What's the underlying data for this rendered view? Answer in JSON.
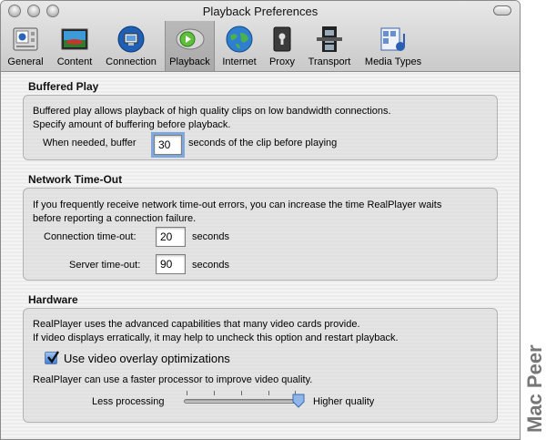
{
  "window": {
    "title": "Playback Preferences"
  },
  "toolbar": {
    "items": [
      {
        "label": "General",
        "icon": "general-panel-icon"
      },
      {
        "label": "Content",
        "icon": "content-image-icon"
      },
      {
        "label": "Connection",
        "icon": "connection-globe-icon"
      },
      {
        "label": "Playback",
        "icon": "playback-icon",
        "selected": true
      },
      {
        "label": "Internet",
        "icon": "internet-globe-icon"
      },
      {
        "label": "Proxy",
        "icon": "proxy-lock-icon"
      },
      {
        "label": "Transport",
        "icon": "transport-film-icon"
      },
      {
        "label": "Media Types",
        "icon": "media-types-icon"
      }
    ]
  },
  "buffered": {
    "title": "Buffered Play",
    "line1": "Buffered play allows playback of high quality clips on low bandwidth connections.",
    "line2": "Specify amount of buffering before playback.",
    "prefix": "When needed, buffer",
    "value": "30",
    "suffix": "seconds of the clip before playing"
  },
  "network": {
    "title": "Network Time-Out",
    "line1": "If you frequently receive network time-out errors, you can increase the time RealPlayer waits",
    "line2": "before reporting a connection failure.",
    "connection_label": "Connection time-out:",
    "connection_value": "20",
    "connection_unit": "seconds",
    "server_label": "Server time-out:",
    "server_value": "90",
    "server_unit": "seconds"
  },
  "hardware": {
    "title": "Hardware",
    "line1": "RealPlayer uses the advanced capabilities that many video cards provide.",
    "line2": "If video displays erratically, it may help to uncheck this option and restart playback.",
    "overlay_label": "Use video overlay optimizations",
    "overlay_checked": true,
    "processor_text": "RealPlayer can use a faster processor to improve video quality.",
    "slider_min_label": "Less processing",
    "slider_max_label": "Higher quality",
    "slider_level": 1.0
  },
  "watermark": "Mac Peer",
  "colors": {
    "accent": "#3f7fd6",
    "focus_ring": "#7ea7dd"
  }
}
